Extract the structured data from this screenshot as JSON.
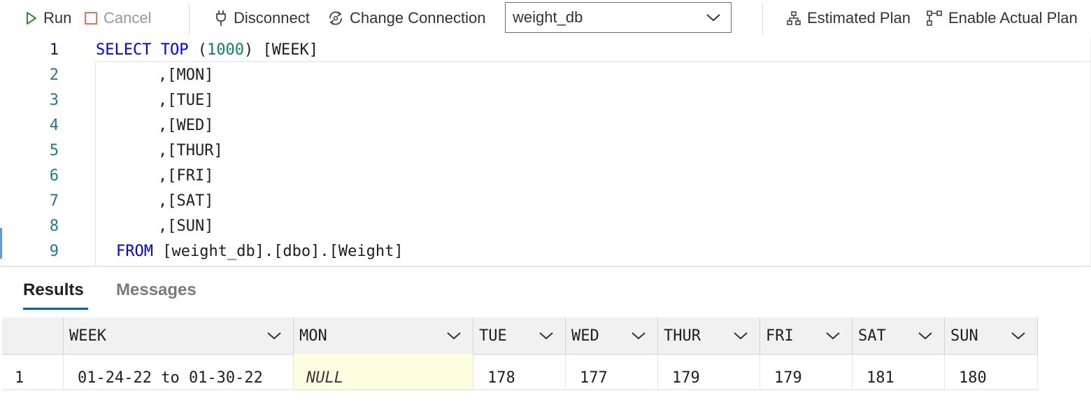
{
  "toolbar": {
    "run_label": "Run",
    "cancel_label": "Cancel",
    "disconnect_label": "Disconnect",
    "change_connection_label": "Change Connection",
    "database_selected": "weight_db",
    "estimated_plan_label": "Estimated Plan",
    "actual_plan_label": "Enable Actual Plan"
  },
  "editor": {
    "line_numbers": [
      "1",
      "2",
      "3",
      "4",
      "5",
      "6",
      "7",
      "8",
      "9"
    ],
    "line1": {
      "select": "SELECT",
      "top": "TOP",
      "open": "(",
      "num": "1000",
      "close": ")",
      "col": "[WEEK]"
    },
    "columns": [
      "[MON]",
      "[TUE]",
      "[WED]",
      "[THUR]",
      "[FRI]",
      "[SAT]",
      "[SUN]"
    ],
    "comma": ",",
    "line9": {
      "from": "FROM",
      "db": "[weight_db]",
      "dot": ".",
      "schema": "[dbo]",
      "table": "[Weight]"
    }
  },
  "results": {
    "tabs": [
      "Results",
      "Messages"
    ],
    "headers": [
      "WEEK",
      "MON",
      "TUE",
      "WED",
      "THUR",
      "FRI",
      "SAT",
      "SUN"
    ],
    "rows": [
      {
        "row_number": "1",
        "cells": [
          "01-24-22 to 01-30-22",
          "NULL",
          "178",
          "177",
          "179",
          "179",
          "181",
          "180"
        ]
      }
    ]
  },
  "colors": {
    "keyword": "#0000ff",
    "number": "#098658",
    "line_number": "#237893",
    "tab_underline": "#0e639c",
    "null_cell_bg": "#fdfde0"
  }
}
